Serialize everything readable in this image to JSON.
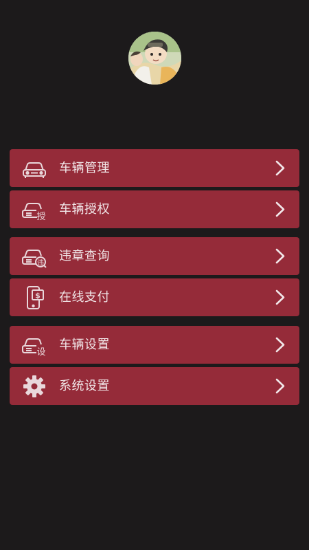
{
  "profile": {
    "avatar_icon": "user-avatar-anime-boy"
  },
  "menu": {
    "items": [
      {
        "label": "车辆管理",
        "icon": "car-icon"
      },
      {
        "label": "车辆授权",
        "icon": "car-authorize-icon",
        "badge": "授"
      },
      {
        "label": "违章查询",
        "icon": "car-violation-icon",
        "badge": "违"
      },
      {
        "label": "在线支付",
        "icon": "phone-payment-icon",
        "badge": "$"
      },
      {
        "label": "车辆设置",
        "icon": "car-settings-icon",
        "badge": "设"
      },
      {
        "label": "系统设置",
        "icon": "gear-icon"
      }
    ]
  },
  "colors": {
    "background": "#1c1a1b",
    "item_bg": "#952b39",
    "item_text": "#f1e6e8"
  }
}
